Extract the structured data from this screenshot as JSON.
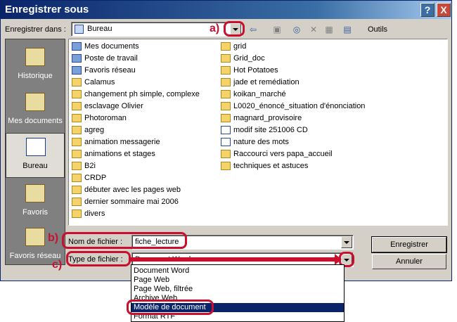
{
  "window": {
    "title": "Enregistrer sous",
    "help": "?",
    "close": "X"
  },
  "save_in": {
    "label": "Enregistrer dans :",
    "value": "Bureau"
  },
  "toolbar": {
    "back": "⇦",
    "up": "▣",
    "search": "◎",
    "delete": "✕",
    "newfolder": "▦",
    "views": "▤",
    "tools": "Outils"
  },
  "places": [
    {
      "label": "Historique",
      "icon": "history-icon"
    },
    {
      "label": "Mes documents",
      "icon": "my-documents-icon"
    },
    {
      "label": "Bureau",
      "icon": "desktop-icon"
    },
    {
      "label": "Favoris",
      "icon": "favorites-icon"
    },
    {
      "label": "Favoris réseau",
      "icon": "network-icon"
    }
  ],
  "files_col1": [
    {
      "name": "Mes documents",
      "icon": "sys"
    },
    {
      "name": "Poste de travail",
      "icon": "sys"
    },
    {
      "name": "Favoris réseau",
      "icon": "sys"
    },
    {
      "name": "Calamus",
      "icon": "folder"
    },
    {
      "name": "changement ph simple, complexe",
      "icon": "folder"
    },
    {
      "name": "esclavage Olivier",
      "icon": "folder"
    },
    {
      "name": "Photoroman",
      "icon": "folder"
    },
    {
      "name": "agreg",
      "icon": "folder"
    },
    {
      "name": "animation messagerie",
      "icon": "folder"
    },
    {
      "name": "animations et stages",
      "icon": "folder"
    },
    {
      "name": "B2i",
      "icon": "folder"
    },
    {
      "name": "CRDP",
      "icon": "folder"
    },
    {
      "name": "débuter avec les pages web",
      "icon": "folder"
    },
    {
      "name": "dernier sommaire mai 2006",
      "icon": "folder"
    },
    {
      "name": "divers",
      "icon": "folder"
    }
  ],
  "files_col2": [
    {
      "name": "grid",
      "icon": "folder"
    },
    {
      "name": "Grid_doc",
      "icon": "folder"
    },
    {
      "name": "Hot Potatoes",
      "icon": "folder"
    },
    {
      "name": "jade et remédiation",
      "icon": "folder"
    },
    {
      "name": "koikan_marché",
      "icon": "folder"
    },
    {
      "name": "L0020_énoncé_situation d'énonciation",
      "icon": "folder"
    },
    {
      "name": "magnard_provisoire",
      "icon": "folder"
    },
    {
      "name": "modif site 251006 CD",
      "icon": "doc"
    },
    {
      "name": "nature des mots",
      "icon": "doc"
    },
    {
      "name": "Raccourci vers papa_accueil",
      "icon": "folder"
    },
    {
      "name": "techniques et astuces",
      "icon": "folder"
    }
  ],
  "filename": {
    "label": "Nom de fichier :",
    "value": "fiche_lecture"
  },
  "filetype": {
    "label": "Type de fichier :",
    "value": "Document Word"
  },
  "buttons": {
    "save": "Enregistrer",
    "cancel": "Annuler"
  },
  "type_options": [
    "Document Word",
    "Page Web",
    "Page Web, filtrée",
    "Archive Web",
    "Modèle de document",
    "Format RTF"
  ],
  "annotations": {
    "a": "a)",
    "b": "b)",
    "c": "c)"
  }
}
